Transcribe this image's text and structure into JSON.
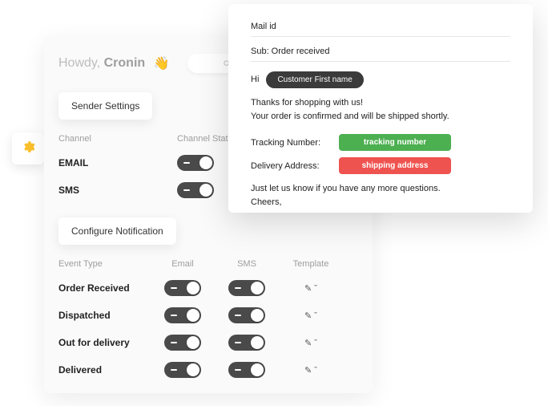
{
  "header": {
    "greeting_prefix": "Howdy, ",
    "greeting_name": "Cronin"
  },
  "sender_settings": {
    "button": "Sender Settings",
    "headers": {
      "channel": "Channel",
      "status": "Channel Status"
    },
    "rows": [
      {
        "label": "EMAIL"
      },
      {
        "label": "SMS"
      }
    ]
  },
  "configure": {
    "button": "Configure Notification",
    "headers": {
      "event": "Event Type",
      "email": "Email",
      "sms": "SMS",
      "template": "Template"
    },
    "events": [
      {
        "label": "Order Received"
      },
      {
        "label": "Dispatched"
      },
      {
        "label": "Out for delivery"
      },
      {
        "label": "Delivered"
      }
    ]
  },
  "preview": {
    "mail_id_label": "Mail id",
    "subject": "Sub: Order received",
    "hi": "Hi",
    "customer_ph": "Customer First name",
    "body_line1": "Thanks for shopping with us!",
    "body_line2": "Your order is confirmed and will be shipped shortly.",
    "tracking_label": "Tracking Number:",
    "tracking_ph": "tracking number",
    "address_label": "Delivery Address:",
    "address_ph": "shipping address",
    "footer_line1": "Just let us know if you have any more questions.",
    "footer_line2": "Cheers,"
  }
}
